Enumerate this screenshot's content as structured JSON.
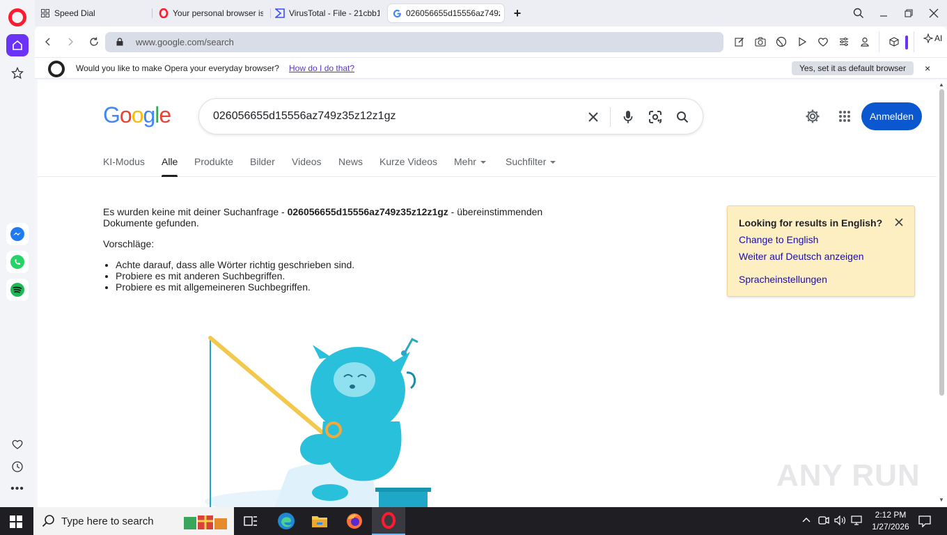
{
  "browser": {
    "tabs": [
      {
        "label": "Speed Dial",
        "icon": "speed-dial-icon"
      },
      {
        "label": "Your personal browser is a",
        "icon": "opera-icon"
      },
      {
        "label": "VirusTotal - File - 21cbb1",
        "icon": "virustotal-icon"
      },
      {
        "label": "026056655d15556az749z",
        "icon": "google-icon"
      }
    ],
    "url": "www.google.com/search",
    "ai_label": "AI"
  },
  "infobar": {
    "text": "Would you like to make Opera your everyday browser?",
    "link": "How do I do that?",
    "button": "Yes, set it as default browser",
    "close": "×"
  },
  "google": {
    "query": "026056655d15556az749z35z12z1gz",
    "login": "Anmelden",
    "tabs": [
      "KI-Modus",
      "Alle",
      "Produkte",
      "Bilder",
      "Videos",
      "News",
      "Kurze Videos",
      "Mehr",
      "Suchfilter"
    ],
    "active_tab": "Alle",
    "no_results_prefix": "Es wurden keine mit deiner Suchanfrage - ",
    "no_results_query": "026056655d15556az749z35z12z1gz",
    "no_results_suffix": " - übereinstimmenden Dokumente gefunden.",
    "suggestions_title": "Vorschläge:",
    "suggestions": [
      "Achte darauf, dass alle Wörter richtig geschrieben sind.",
      "Probiere es mit anderen Suchbegriffen.",
      "Probiere es mit allgemeineren Suchbegriffen."
    ],
    "lang_card": {
      "title": "Looking for results in English?",
      "link1": "Change to English",
      "link2": "Weiter auf Deutsch anzeigen",
      "link3": "Spracheinstellungen"
    }
  },
  "watermark": "ANY RUN",
  "taskbar": {
    "search_placeholder": "Type here to search",
    "time": "2:12 PM",
    "date": "1/27/2026"
  },
  "colors": {
    "opera_red": "#ff1b2d",
    "opera_purple": "#6b33f6",
    "google_blue": "#0b57d0",
    "link_blue": "#1a0dab",
    "card_bg": "#feefc3"
  }
}
